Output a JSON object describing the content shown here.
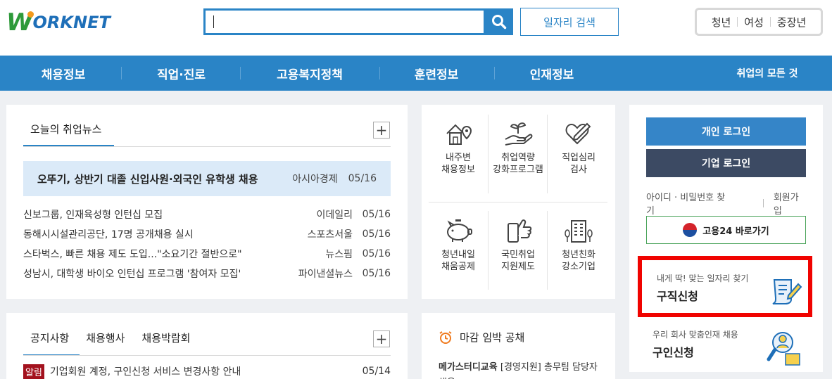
{
  "header": {
    "logo_first": "W",
    "logo_rest": "ORKNET",
    "search": {
      "value": "",
      "placeholder": ""
    },
    "job_search_label": "일자리 검색",
    "audience": [
      "청년",
      "여성",
      "중장년"
    ]
  },
  "nav": {
    "items": [
      "채용정보",
      "직업·진로",
      "고용복지정책",
      "훈련정보",
      "인재정보"
    ],
    "all_label": "취업의 모든 것"
  },
  "news": {
    "tab_label": "오늘의 취업뉴스",
    "headline": {
      "title": "오뚜기, 상반기 대졸 신입사원·외국인 유학생 채용",
      "source": "아시아경제",
      "date": "05/16"
    },
    "items": [
      {
        "title": "신보그룹, 인재육성형 인턴십 모집",
        "source": "이데일리",
        "date": "05/16"
      },
      {
        "title": "동해시시설관리공단, 17명 공개채용 실시",
        "source": "스포츠서울",
        "date": "05/16"
      },
      {
        "title": "스타벅스, 빠른 채용 제도 도입...\"소요기간 절반으로\"",
        "source": "뉴스핌",
        "date": "05/16"
      },
      {
        "title": "성남시, 대학생 바이오 인턴십 프로그램 '참여자 모집'",
        "source": "파이낸셜뉴스",
        "date": "05/16"
      }
    ]
  },
  "notice": {
    "tabs": [
      "공지사항",
      "채용행사",
      "채용박람회"
    ],
    "items": [
      {
        "badge": "알림",
        "title": "기업회원 계정, 구인신청 서비스 변경사항 안내",
        "date": "05/14"
      }
    ]
  },
  "services": [
    {
      "label": "내주변\n채용정보",
      "icon": "house-location-icon"
    },
    {
      "label": "취업역량\n강화프로그램",
      "icon": "hand-sprout-icon"
    },
    {
      "label": "직업심리\n검사",
      "icon": "heart-pencil-icon"
    },
    {
      "label": "청년내일\n채움공제",
      "icon": "piggy-bank-icon"
    },
    {
      "label": "국민취업\n지원제도",
      "icon": "thumbs-up-phone-icon"
    },
    {
      "label": "청년친화\n강소기업",
      "icon": "building-icon"
    }
  ],
  "deadline": {
    "title": "마감 임박 공채",
    "item_company": "메가스터디교육",
    "item_text": "[경영지원] 총무팀 담당자 채용"
  },
  "login": {
    "personal_label": "개인 로그인",
    "company_label": "기업 로그인",
    "find_label": "아이디 · 비밀번호 찾기",
    "join_label": "회원가입",
    "goyong_label": "고용24 바로가기"
  },
  "job_seek": {
    "sub": "내게 딱! 맞는 일자리 찾기",
    "title": "구직신청"
  },
  "recruit": {
    "sub": "우리 회사 맞춤인재 채용",
    "title": "구인신청"
  },
  "colors": {
    "primary": "#2a84c6",
    "dark": "#3c4a63",
    "highlight": "#f00300",
    "badge": "#a3121e"
  }
}
